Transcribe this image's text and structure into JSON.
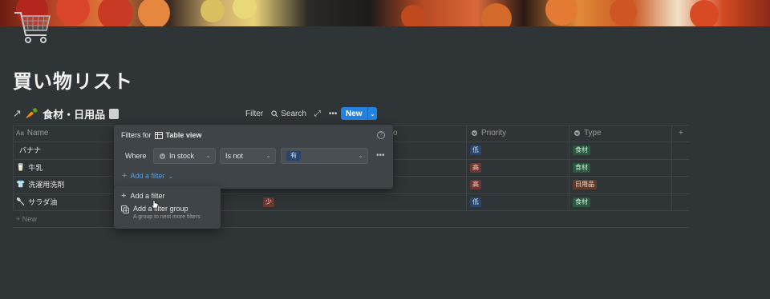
{
  "page": {
    "title": "買い物リスト"
  },
  "database": {
    "title": "食材・日用品",
    "carrot_emoji": "🥕"
  },
  "toolbar": {
    "filter_label": "Filter",
    "search_label": "Search",
    "new_label": "New"
  },
  "table": {
    "columns": [
      {
        "label": "Name",
        "icon": "title-icon"
      },
      {
        "label": "o",
        "icon": ""
      },
      {
        "label": "Priority",
        "icon": "select-icon"
      },
      {
        "label": "Type",
        "icon": "select-icon"
      }
    ],
    "rows": [
      {
        "emoji": "",
        "name": "バナナ",
        "stock": "",
        "priority": "低",
        "type": "食材"
      },
      {
        "emoji": "🥛",
        "name": "牛乳",
        "stock": "",
        "priority": "高",
        "type": "食材"
      },
      {
        "emoji": "👕",
        "name": "洗濯用洗剤",
        "stock": "",
        "priority": "高",
        "type": "日用品"
      },
      {
        "emoji": "🥄",
        "name": "サラダ油",
        "stock": "少",
        "priority": "低",
        "type": "食材"
      }
    ],
    "new_row_label": "New"
  },
  "filter_panel": {
    "title_prefix": "Filters for",
    "view_name": "Table view",
    "where_label": "Where",
    "property": "In stock",
    "operator": "Is not",
    "value": "有",
    "add_filter_label": "Add a filter"
  },
  "add_menu": {
    "item1": "Add a filter",
    "item2": "Add a filter group",
    "item2_sub": "A group to nest more filters"
  },
  "colors": {
    "accent": "#2383e2",
    "background": "#2f3437",
    "panel": "#3f4448"
  }
}
